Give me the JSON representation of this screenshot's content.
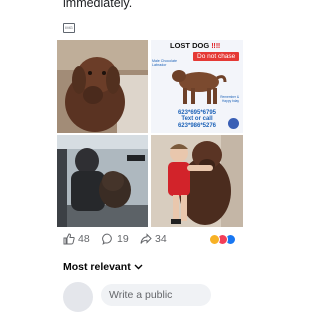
{
  "post": {
    "text_tail": "immediately.",
    "media_placeholder_icon": "broken-image-icon"
  },
  "photos": [
    {
      "name": "photo-dog-closeup",
      "description_icon": "dog-photo"
    },
    {
      "name": "photo-lost-dog-flyer"
    },
    {
      "name": "photo-man-with-dog-in-car",
      "description_icon": "dog-photo"
    },
    {
      "name": "photo-child-hugging-dog",
      "description_icon": "dog-photo"
    }
  ],
  "flyer": {
    "title": "LOST DOG",
    "title_marks": "‼‼",
    "badge": "Do not chase",
    "breed": "Male Chocolate Labrador",
    "note": "Remember & Happy bday",
    "phone_1": "623*695*6795",
    "call_text": "Text or call",
    "phone_2": "623*986*5276"
  },
  "stats": {
    "likes": "48",
    "comments": "19",
    "shares": "34",
    "reaction_icons": [
      "haha",
      "love",
      "like"
    ]
  },
  "comments": {
    "sort_label": "Most relevant",
    "input_placeholder": "Write a public"
  },
  "colors": {
    "link_blue": "#1e63b8",
    "alert_red": "#e53935",
    "muted": "#65676b"
  }
}
